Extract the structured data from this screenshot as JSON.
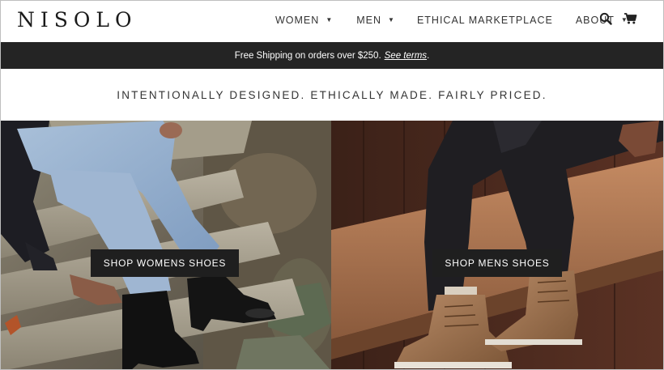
{
  "brand": {
    "logo": "NISOLO"
  },
  "nav": {
    "women": "WOMEN",
    "men": "MEN",
    "ethical": "ETHICAL MARKETPLACE",
    "about": "ABOUT",
    "caret_icon": "caret-down-icon",
    "search_icon": "search-icon",
    "cart_icon": "cart-icon"
  },
  "announcement": {
    "text": "Free Shipping on orders over $250.",
    "link": "See terms",
    "suffix": "."
  },
  "tagline": "INTENTIONALLY DESIGNED. ETHICALLY MADE. FAIRLY PRICED.",
  "hero": {
    "women_cta": "SHOP WOMENS SHOES",
    "men_cta": "SHOP MENS SHOES"
  },
  "colors": {
    "announcement_bg": "#242424",
    "cta_bg": "#1f1f1f",
    "text": "#333333"
  }
}
